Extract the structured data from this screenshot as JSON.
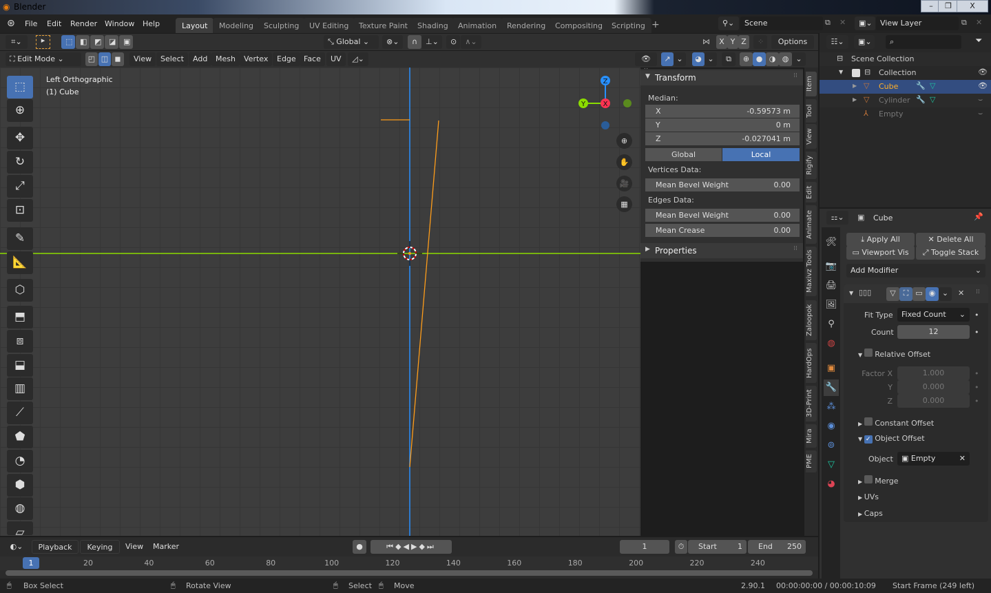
{
  "window": {
    "title": "Blender",
    "minimize": "–",
    "restore": "❐",
    "close": "X"
  },
  "menu": [
    "File",
    "Edit",
    "Render",
    "Window",
    "Help"
  ],
  "workspaces": [
    {
      "label": "Layout",
      "active": true
    },
    {
      "label": "Modeling"
    },
    {
      "label": "Sculpting"
    },
    {
      "label": "UV Editing"
    },
    {
      "label": "Texture Paint"
    },
    {
      "label": "Shading"
    },
    {
      "label": "Animation"
    },
    {
      "label": "Rendering"
    },
    {
      "label": "Compositing"
    },
    {
      "label": "Scripting"
    }
  ],
  "add_workspace": "+",
  "scene": {
    "value": "Scene"
  },
  "view_layer": {
    "value": "View Layer"
  },
  "tool_header": {
    "orientation": "Global",
    "axes": [
      "X",
      "Y",
      "Z"
    ],
    "options": "Options"
  },
  "viewport_header": {
    "mode": "Edit Mode",
    "menus": [
      "View",
      "Select",
      "Add",
      "Mesh",
      "Vertex",
      "Edge",
      "Face",
      "UV"
    ]
  },
  "viewport": {
    "view_name": "Left Orthographic",
    "object_label": "(1) Cube",
    "gizmo": {
      "x": "X",
      "y": "Y",
      "z": "Z"
    },
    "colors": {
      "x_axis": "#ff3352",
      "y_axis": "#8bdc00",
      "z_axis": "#2890ff",
      "edge": "#ff9d1a",
      "grid": "#3d3d3d"
    }
  },
  "tools": [
    "select-box",
    "cursor",
    "move",
    "rotate",
    "scale",
    "transform",
    "annotate",
    "measure",
    "add-cube",
    "extrude",
    "inset",
    "bevel",
    "loop-cut",
    "knife",
    "poly-build",
    "spin",
    "smooth",
    "shrink-fatten",
    "shear"
  ],
  "npanel": {
    "transform_title": "Transform",
    "median_label": "Median:",
    "median": [
      {
        "axis": "X",
        "value": "-0.59573 m"
      },
      {
        "axis": "Y",
        "value": "0 m"
      },
      {
        "axis": "Z",
        "value": "-0.027041 m"
      }
    ],
    "space": {
      "global": "Global",
      "local": "Local",
      "active": "Local"
    },
    "vertices_label": "Vertices Data:",
    "vertex_bevel": {
      "label": "Mean Bevel Weight",
      "value": "0.00"
    },
    "edges_label": "Edges Data:",
    "edge_bevel": {
      "label": "Mean Bevel Weight",
      "value": "0.00"
    },
    "edge_crease": {
      "label": "Mean Crease",
      "value": "0.00"
    },
    "properties_title": "Properties",
    "tabs": [
      "Item",
      "Tool",
      "View",
      "Rigify",
      "Edit",
      "Animate",
      "Maxivz Tools",
      "Zaloopok",
      "HardOps",
      "3D-Print",
      "Mira",
      "PME"
    ]
  },
  "outliner": {
    "root": "Scene Collection",
    "collection": "Collection",
    "items": [
      {
        "name": "Cube",
        "selected": true
      },
      {
        "name": "Cylinder"
      },
      {
        "name": "Empty"
      }
    ]
  },
  "properties": {
    "object": "Cube",
    "apply_all": "Apply All",
    "delete_all": "Delete All",
    "viewport_vis": "Viewport Vis",
    "toggle_stack": "Toggle Stack",
    "add_modifier": "Add Modifier",
    "fit_type_label": "Fit Type",
    "fit_type": "Fixed Count",
    "count_label": "Count",
    "count": "12",
    "relative_offset": {
      "label": "Relative Offset",
      "checked": false
    },
    "factor": [
      {
        "label": "Factor X",
        "value": "1.000"
      },
      {
        "label": "Y",
        "value": "0.000"
      },
      {
        "label": "Z",
        "value": "0.000"
      }
    ],
    "constant_offset": {
      "label": "Constant Offset",
      "checked": false
    },
    "object_offset": {
      "label": "Object Offset",
      "checked": true
    },
    "object_label": "Object",
    "object_value": "Empty",
    "merge": {
      "label": "Merge",
      "checked": false
    },
    "uvs": "UVs",
    "caps": "Caps"
  },
  "timeline": {
    "menus": [
      "Playback",
      "Keying",
      "View",
      "Marker"
    ],
    "current_frame": "1",
    "start_label": "Start",
    "start": "1",
    "end_label": "End",
    "end": "250",
    "ticks": [
      "20",
      "40",
      "60",
      "80",
      "100",
      "120",
      "140",
      "160",
      "180",
      "200",
      "220",
      "240"
    ]
  },
  "status": {
    "box_select": "Box Select",
    "rotate_view": "Rotate View",
    "select": "Select",
    "move": "Move",
    "version": "2.90.1",
    "time": "00:00:00:00 / 00:00:10:09",
    "frame_info": "Start Frame (249 left)"
  }
}
